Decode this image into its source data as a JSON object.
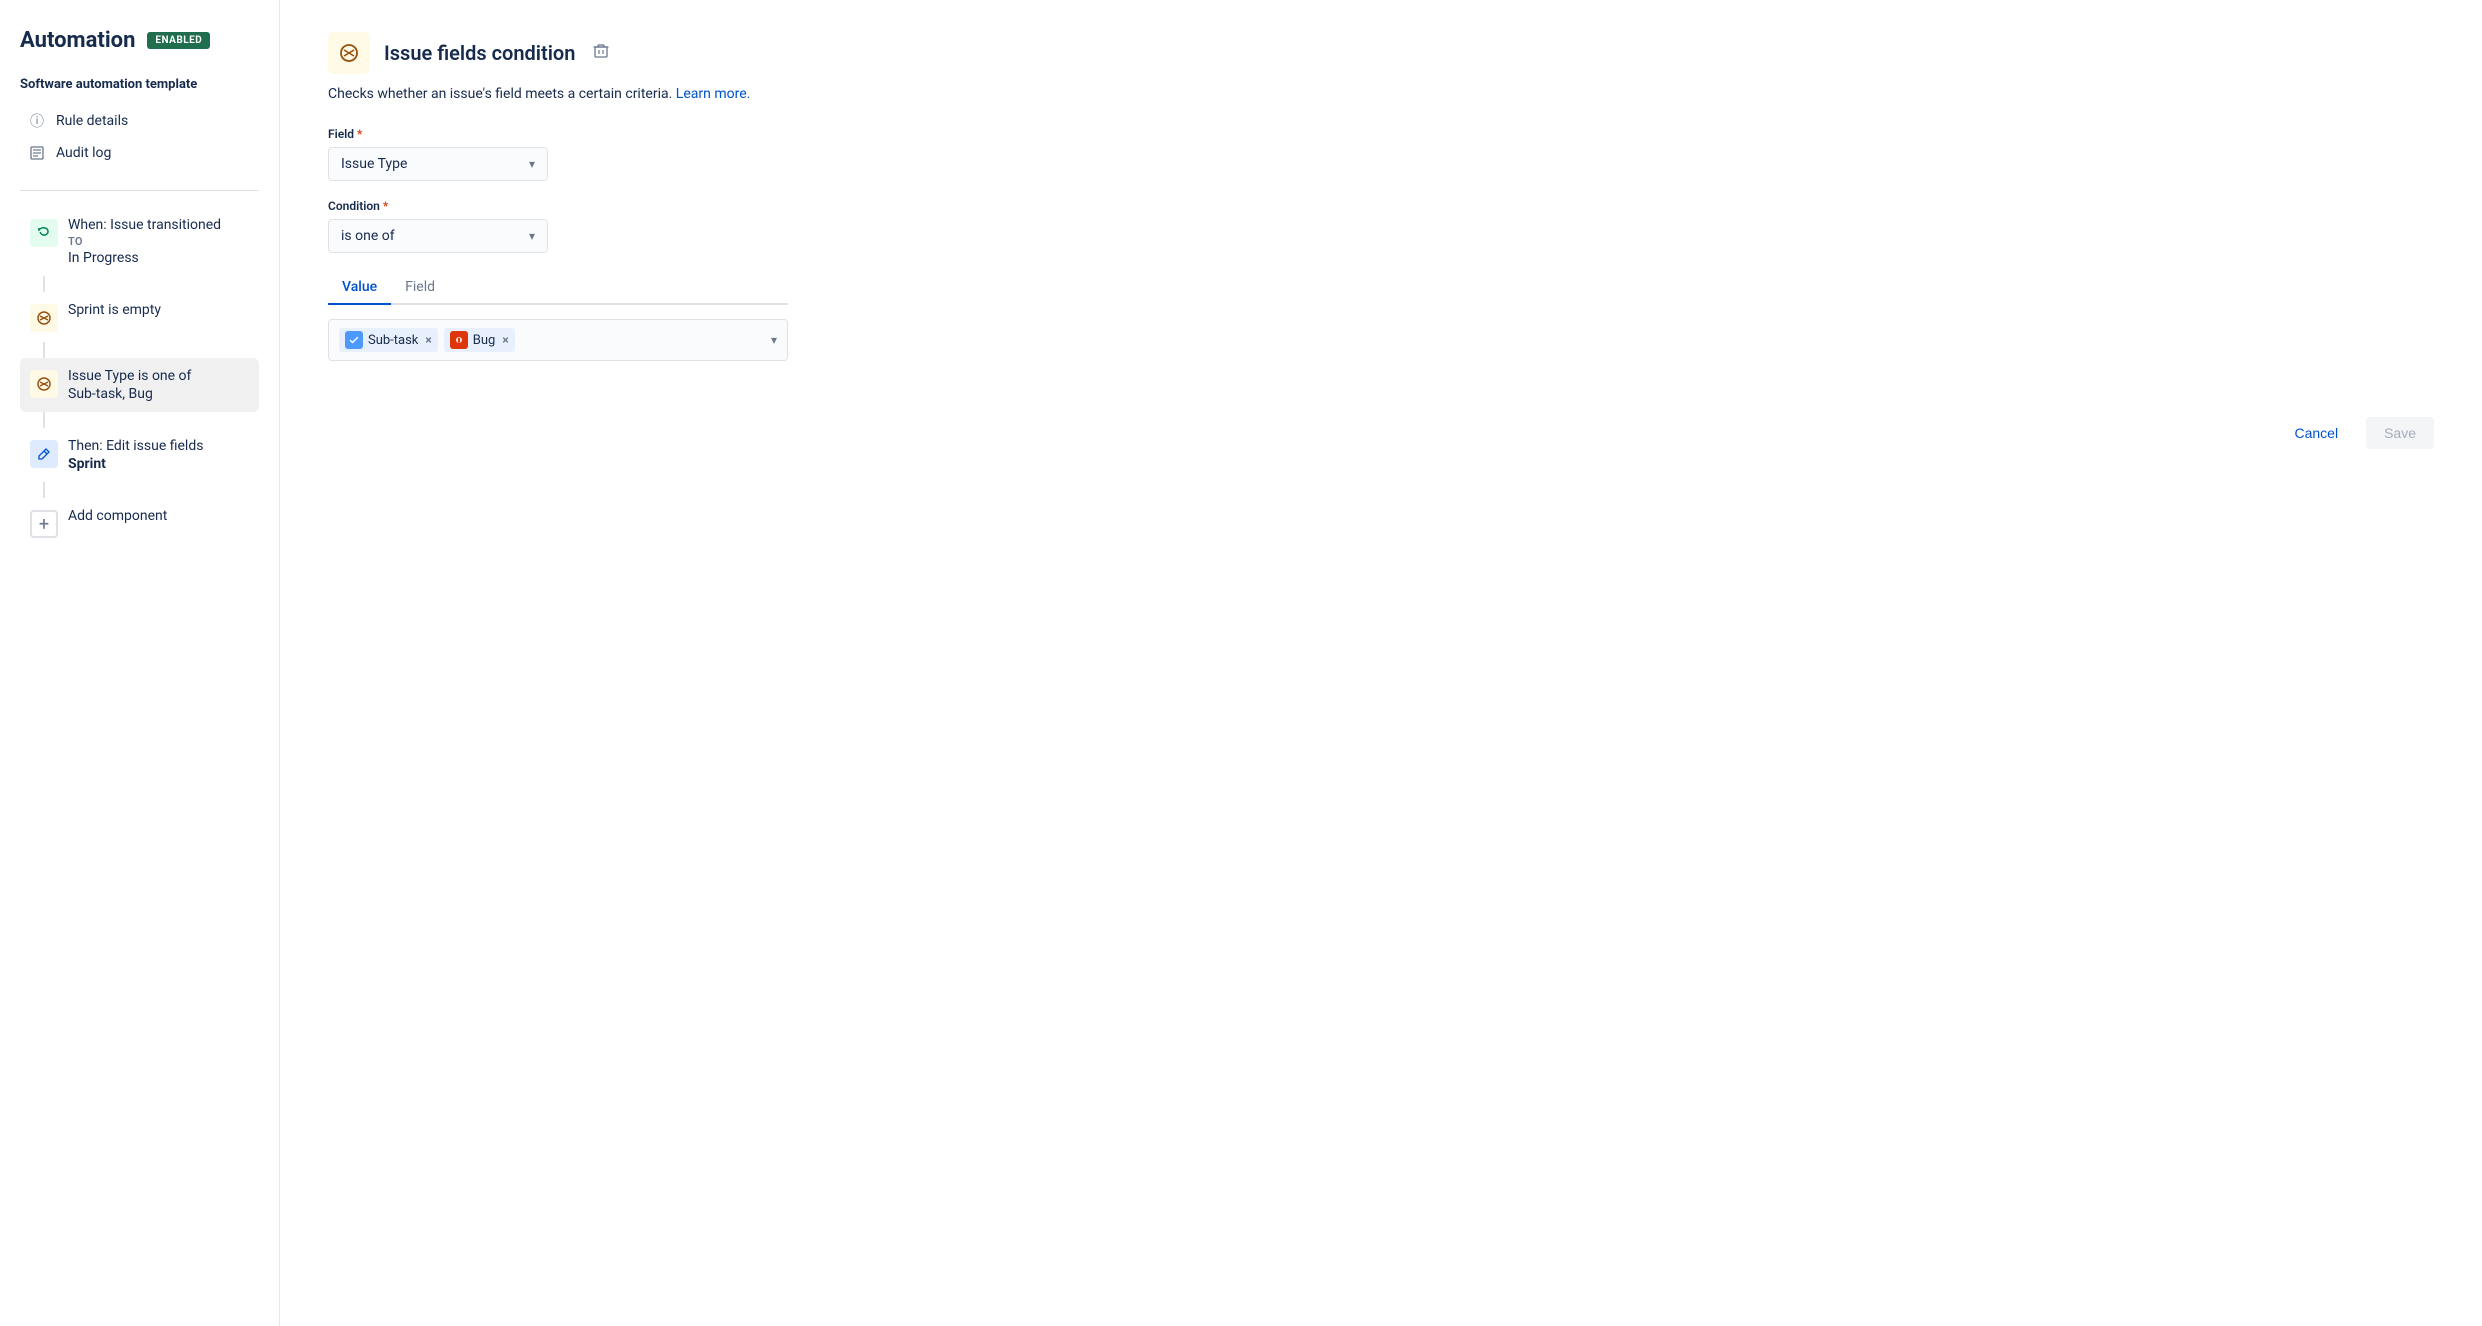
{
  "app": {
    "title": "Automation",
    "status_badge": "ENABLED"
  },
  "sidebar": {
    "template_label": "Software automation template",
    "nav_items": [
      {
        "id": "rule-details",
        "label": "Rule details",
        "icon": "ⓘ"
      },
      {
        "id": "audit-log",
        "label": "Audit log",
        "icon": "📋"
      }
    ],
    "steps": [
      {
        "id": "trigger",
        "icon_type": "green",
        "icon": "↩",
        "label": "When: Issue transitioned",
        "sub": "TO",
        "detail": "In Progress"
      },
      {
        "id": "condition-sprint",
        "icon_type": "yellow",
        "icon": "⇄",
        "label": "Sprint is empty",
        "sub": "",
        "detail": ""
      },
      {
        "id": "condition-issue-type",
        "icon_type": "yellow",
        "icon": "⇄",
        "label": "Issue Type is one of",
        "sub": "",
        "detail": "Sub-task, Bug",
        "active": true
      },
      {
        "id": "action-edit",
        "icon_type": "blue",
        "icon": "✏",
        "label": "Then: Edit issue fields",
        "sub": "",
        "detail": "Sprint",
        "detail_bold": true
      },
      {
        "id": "add-component",
        "icon_type": "circle",
        "icon": "+",
        "label": "Add component",
        "sub": "",
        "detail": ""
      }
    ]
  },
  "panel": {
    "title": "Issue fields condition",
    "description": "Checks whether an issue's field meets a certain criteria.",
    "learn_more_text": "Learn more.",
    "field_label": "Field",
    "field_value": "Issue Type",
    "condition_label": "Condition",
    "condition_value": "is one of",
    "tabs": [
      {
        "id": "value",
        "label": "Value",
        "active": true
      },
      {
        "id": "field",
        "label": "Field",
        "active": false
      }
    ],
    "selected_values": [
      {
        "id": "subtask",
        "label": "Sub-task",
        "icon_type": "blue-sq",
        "icon": "S"
      },
      {
        "id": "bug",
        "label": "Bug",
        "icon_type": "red-sq",
        "icon": "B"
      }
    ]
  },
  "footer": {
    "cancel_label": "Cancel",
    "save_label": "Save"
  }
}
